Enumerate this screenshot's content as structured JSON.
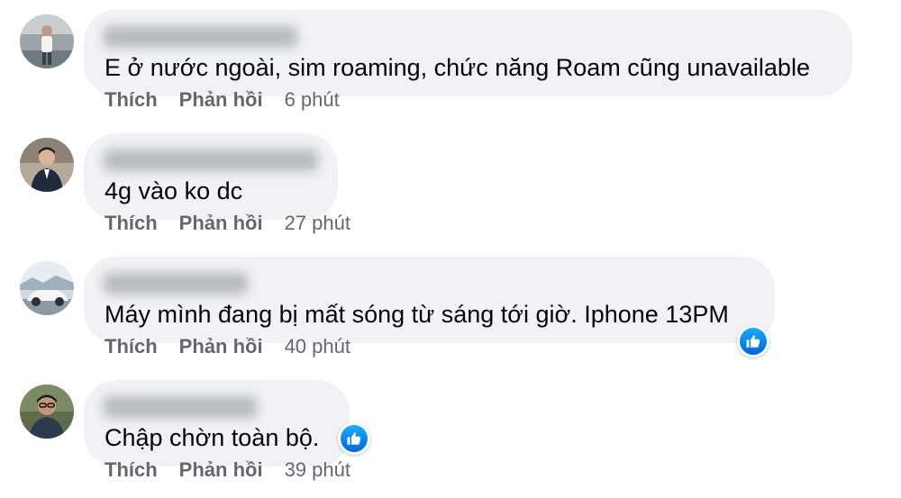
{
  "comments": [
    {
      "author": "",
      "text": "E ở nước ngoài, sim roaming, chức năng Roam cũng unavailable",
      "like_label": "Thích",
      "reply_label": "Phản hồi",
      "time": "6 phút",
      "has_reaction": false,
      "avatar_icon": "user-avatar-photo"
    },
    {
      "author": "",
      "text": "4g vào ko dc",
      "like_label": "Thích",
      "reply_label": "Phản hồi",
      "time": "27 phút",
      "has_reaction": false,
      "avatar_icon": "user-avatar-photo"
    },
    {
      "author": "",
      "text": "Máy mình đang bị mất sóng từ sáng tới giờ. Iphone 13PM",
      "like_label": "Thích",
      "reply_label": "Phản hồi",
      "time": "40 phút",
      "has_reaction": true,
      "reaction_icon": "like-thumbs-up-icon",
      "avatar_icon": "user-avatar-photo"
    },
    {
      "author": "",
      "text": "Chập chờn toàn bộ.",
      "like_label": "Thích",
      "reply_label": "Phản hồi",
      "time": "39 phút",
      "has_reaction": true,
      "reaction_icon": "like-thumbs-up-icon",
      "avatar_icon": "user-avatar-photo"
    }
  ],
  "colors": {
    "bubble": "#f0f2f5",
    "text": "#050505",
    "meta": "#65676b",
    "like_blue": "#0866ff"
  }
}
